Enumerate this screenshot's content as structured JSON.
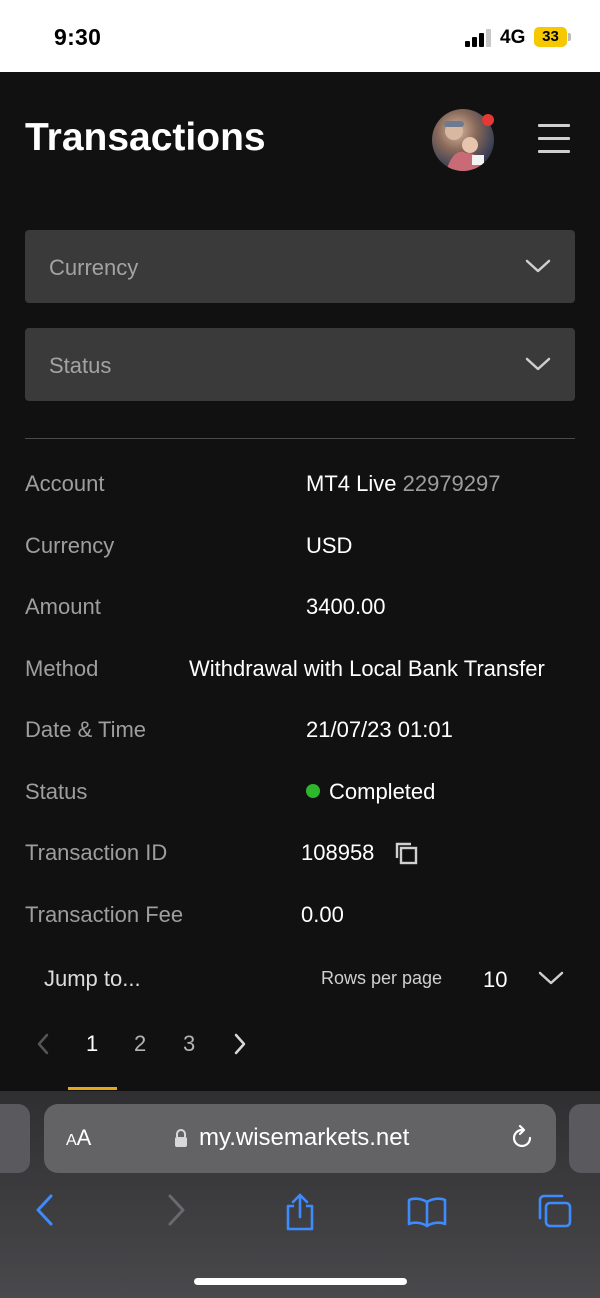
{
  "status_bar": {
    "time": "9:30",
    "network": "4G",
    "battery": "33"
  },
  "header": {
    "title": "Transactions"
  },
  "filters": {
    "currency_placeholder": "Currency",
    "status_placeholder": "Status"
  },
  "transaction": {
    "account_label": "Account",
    "account_type": "MT4 Live",
    "account_number": "22979297",
    "currency_label": "Currency",
    "currency_value": "USD",
    "amount_label": "Amount",
    "amount_value": "3400.00",
    "method_label": "Method",
    "method_value": "Withdrawal with Local Bank Transfer",
    "datetime_label": "Date & Time",
    "datetime_value": "21/07/23 01:01",
    "status_label": "Status",
    "status_value": "Completed",
    "status_color": "#2eb62c",
    "id_label": "Transaction ID",
    "id_value": "108958",
    "fee_label": "Transaction Fee",
    "fee_value": "0.00"
  },
  "pagination": {
    "jump_label": "Jump to...",
    "rows_per_page_label": "Rows per page",
    "rows_per_page_value": "10",
    "pages": [
      "1",
      "2",
      "3"
    ],
    "active_page": "1",
    "accent_color": "#e6a817"
  },
  "browser": {
    "text_size_label_small": "A",
    "text_size_label_large": "A",
    "url": "my.wisemarkets.net",
    "accent_color": "#3d8bfd"
  }
}
